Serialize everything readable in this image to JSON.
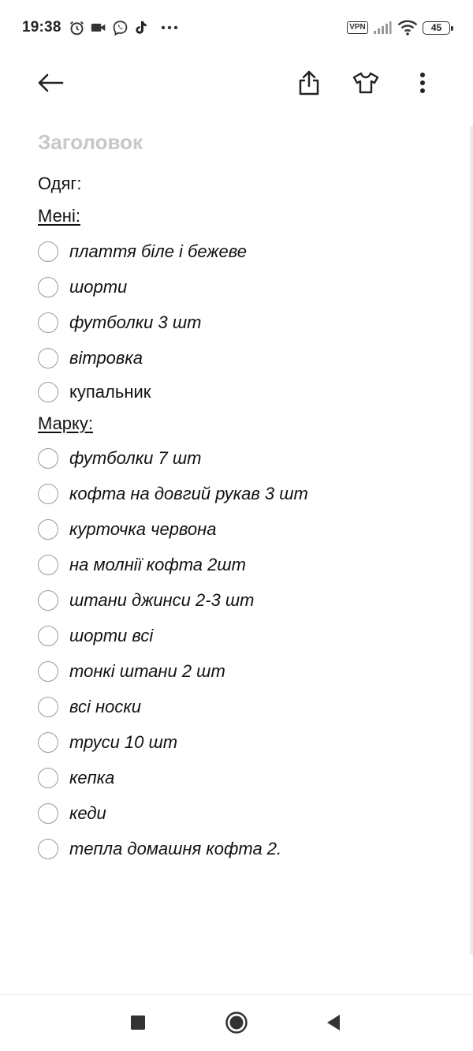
{
  "status_bar": {
    "time": "19:38",
    "vpn": "VPN",
    "battery": "45",
    "icons": [
      "alarm-icon",
      "video-camera-icon",
      "viber-icon",
      "tiktok-icon",
      "more-dots-icon",
      "signal-icon",
      "wifi-icon"
    ]
  },
  "toolbar": {
    "icons": [
      "arrow-back-icon",
      "share-icon",
      "tshirt-icon",
      "more-vertical-icon"
    ]
  },
  "note": {
    "title_placeholder": "Заголовок",
    "heading": "Одяг:",
    "section1": {
      "label": "Мені:",
      "items": [
        {
          "text": "плаття біле і бежеве",
          "checked": false
        },
        {
          "text": "шорти",
          "checked": false
        },
        {
          "text": "футболки 3 шт",
          "checked": false
        },
        {
          "text": "вітровка",
          "checked": false
        },
        {
          "text": "купальник",
          "checked": false
        }
      ]
    },
    "section2": {
      "label": "Марку:",
      "items": [
        {
          "text": "футболки 7 шт",
          "checked": false
        },
        {
          "text": "кофта на довгий рукав 3 шт",
          "checked": false
        },
        {
          "text": "курточка червона",
          "checked": false
        },
        {
          "text": "на молнії кофта 2шт",
          "checked": false
        },
        {
          "text": "штани джинси 2-3 шт",
          "checked": false
        },
        {
          "text": "шорти всі",
          "checked": false
        },
        {
          "text": "тонкі штани 2 шт",
          "checked": false
        },
        {
          "text": "всі носки",
          "checked": false
        },
        {
          "text": "труси 10 шт",
          "checked": false
        },
        {
          "text": "кепка",
          "checked": false
        },
        {
          "text": "кеди",
          "checked": false
        },
        {
          "text": "тепла домашня кофта 2.",
          "checked": false
        }
      ]
    }
  },
  "nav_bar": {
    "icons": [
      "recents-square-icon",
      "home-circle-icon",
      "back-triangle-icon"
    ]
  }
}
